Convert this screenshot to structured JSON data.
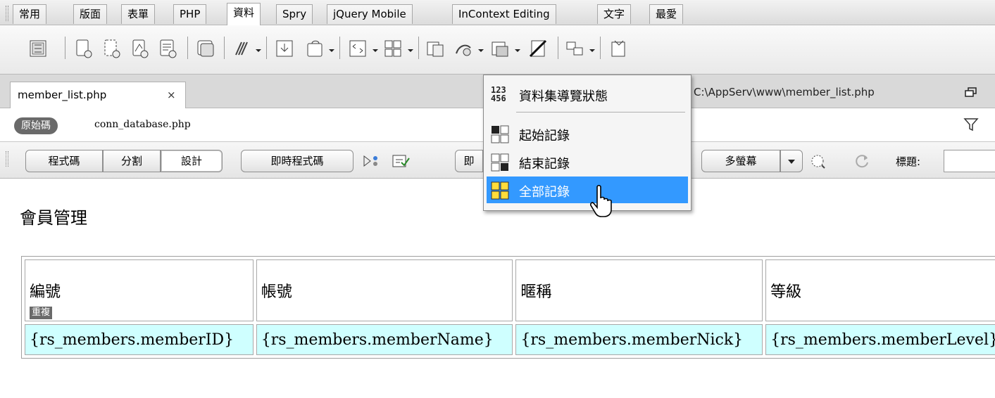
{
  "category_tabs": [
    {
      "label": "常用"
    },
    {
      "label": "版面"
    },
    {
      "label": "表單"
    },
    {
      "label": "PHP"
    },
    {
      "label": "資料",
      "active": true
    },
    {
      "label": "Spry"
    },
    {
      "label": "jQuery Mobile"
    },
    {
      "label": "InContext Editing"
    },
    {
      "label": "文字"
    },
    {
      "label": "最愛"
    }
  ],
  "document": {
    "tab_label": "member_list.php",
    "close_glyph": "×",
    "path": "C:\\AppServ\\www\\member_list.php"
  },
  "related_files": {
    "source_label": "原始碼",
    "file": "conn_database.php"
  },
  "doc_toolbar": {
    "code_label": "程式碼",
    "split_label": "分割",
    "design_label": "設計",
    "live_code_label": "即時程式碼",
    "live_view_label": "即",
    "multiscreen_label": "多螢幕",
    "title_label": "標題:",
    "title_value": ""
  },
  "design_view": {
    "page_title": "會員管理",
    "repeat_tag": "重複",
    "columns": [
      "編號",
      "帳號",
      "暱稱",
      "等級"
    ],
    "row": [
      "{rs_members.memberID}",
      "{rs_members.memberName}",
      "{rs_members.memberNick}",
      "{rs_members.memberLevel}"
    ]
  },
  "dropdown_menu": {
    "header_item": {
      "label": "資料集導覽狀態",
      "icon": "recordset-status-icon",
      "icon_digits": [
        "123",
        "456"
      ]
    },
    "items": [
      {
        "label": "起始記錄",
        "icon": "start-record-icon"
      },
      {
        "label": "結束記錄",
        "icon": "end-record-icon"
      },
      {
        "label": "全部記錄",
        "icon": "all-records-icon",
        "highlighted": true
      }
    ]
  },
  "colors": {
    "menu_highlight": "#3399ff",
    "dynamic_cell": "#cfffff",
    "tag_bg": "#6a6a6a"
  }
}
